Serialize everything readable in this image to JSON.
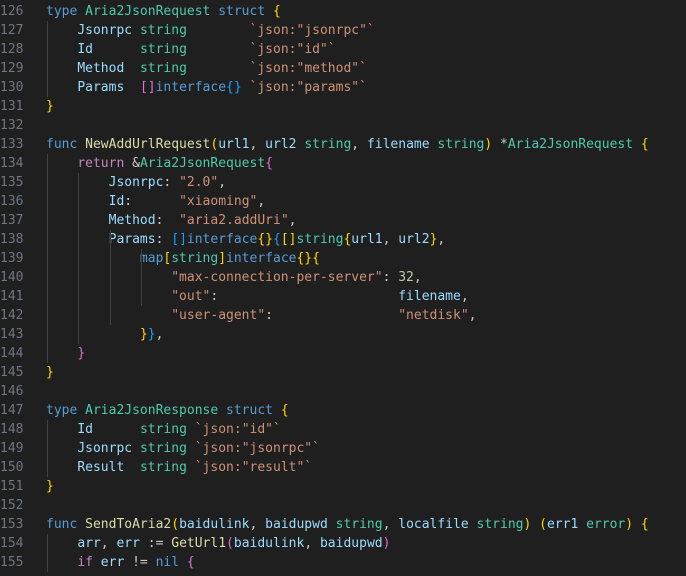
{
  "editor": {
    "language": "go",
    "theme": {
      "background": "#1f1f1f",
      "gutter": "#6e7681",
      "text": "#cccccc"
    },
    "lines": [
      {
        "n": "126",
        "tokens": [
          [
            "kw",
            "type"
          ],
          [
            "pl",
            " "
          ],
          [
            "ty",
            "Aria2JsonRequest"
          ],
          [
            "pl",
            " "
          ],
          [
            "kw",
            "struct"
          ],
          [
            "pl",
            " "
          ],
          [
            "b1",
            "{"
          ]
        ]
      },
      {
        "n": "127",
        "tokens": [
          [
            "pl",
            "    "
          ],
          [
            "var",
            "Jsonrpc"
          ],
          [
            "pl",
            " "
          ],
          [
            "ty",
            "string"
          ],
          [
            "pl",
            "        "
          ],
          [
            "str",
            "`json:\"jsonrpc\"`"
          ]
        ]
      },
      {
        "n": "128",
        "tokens": [
          [
            "pl",
            "    "
          ],
          [
            "var",
            "Id"
          ],
          [
            "pl",
            "      "
          ],
          [
            "ty",
            "string"
          ],
          [
            "pl",
            "        "
          ],
          [
            "str",
            "`json:\"id\"`"
          ]
        ]
      },
      {
        "n": "129",
        "tokens": [
          [
            "pl",
            "    "
          ],
          [
            "var",
            "Method"
          ],
          [
            "pl",
            "  "
          ],
          [
            "ty",
            "string"
          ],
          [
            "pl",
            "        "
          ],
          [
            "str",
            "`json:\"method\"`"
          ]
        ]
      },
      {
        "n": "130",
        "tokens": [
          [
            "pl",
            "    "
          ],
          [
            "var",
            "Params"
          ],
          [
            "pl",
            "  "
          ],
          [
            "b2",
            "[]"
          ],
          [
            "kw",
            "interface"
          ],
          [
            "b3",
            "{}"
          ],
          [
            "pl",
            " "
          ],
          [
            "str",
            "`json:\"params\"`"
          ]
        ]
      },
      {
        "n": "131",
        "tokens": [
          [
            "b1",
            "}"
          ]
        ]
      },
      {
        "n": "132",
        "tokens": []
      },
      {
        "n": "133",
        "tokens": [
          [
            "kw",
            "func"
          ],
          [
            "pl",
            " "
          ],
          [
            "fn",
            "NewAddUrlRequest"
          ],
          [
            "b1",
            "("
          ],
          [
            "var",
            "url1"
          ],
          [
            "pl",
            ", "
          ],
          [
            "var",
            "url2"
          ],
          [
            "pl",
            " "
          ],
          [
            "ty",
            "string"
          ],
          [
            "pl",
            ", "
          ],
          [
            "var",
            "filename"
          ],
          [
            "pl",
            " "
          ],
          [
            "ty",
            "string"
          ],
          [
            "b1",
            ")"
          ],
          [
            "pl",
            " *"
          ],
          [
            "ty",
            "Aria2JsonRequest"
          ],
          [
            "pl",
            " "
          ],
          [
            "b1",
            "{"
          ]
        ]
      },
      {
        "n": "134",
        "tokens": [
          [
            "pl",
            "    "
          ],
          [
            "ctl",
            "return"
          ],
          [
            "pl",
            " &"
          ],
          [
            "ty",
            "Aria2JsonRequest"
          ],
          [
            "b2",
            "{"
          ]
        ]
      },
      {
        "n": "135",
        "tokens": [
          [
            "pl",
            "        "
          ],
          [
            "var",
            "Jsonrpc"
          ],
          [
            "pl",
            ": "
          ],
          [
            "str",
            "\"2.0\""
          ],
          [
            "pl",
            ","
          ]
        ]
      },
      {
        "n": "136",
        "tokens": [
          [
            "pl",
            "        "
          ],
          [
            "var",
            "Id"
          ],
          [
            "pl",
            ":      "
          ],
          [
            "str",
            "\"xiaoming\""
          ],
          [
            "pl",
            ","
          ]
        ]
      },
      {
        "n": "137",
        "tokens": [
          [
            "pl",
            "        "
          ],
          [
            "var",
            "Method"
          ],
          [
            "pl",
            ":  "
          ],
          [
            "str",
            "\"aria2.addUri\""
          ],
          [
            "pl",
            ","
          ]
        ]
      },
      {
        "n": "138",
        "tokens": [
          [
            "pl",
            "        "
          ],
          [
            "var",
            "Params"
          ],
          [
            "pl",
            ": "
          ],
          [
            "b3",
            "[]"
          ],
          [
            "kw",
            "interface"
          ],
          [
            "b1",
            "{}"
          ],
          [
            "b3",
            "{"
          ],
          [
            "b1",
            "[]"
          ],
          [
            "ty",
            "string"
          ],
          [
            "b1",
            "{"
          ],
          [
            "var",
            "url1"
          ],
          [
            "pl",
            ", "
          ],
          [
            "var",
            "url2"
          ],
          [
            "b1",
            "}"
          ],
          [
            "pl",
            ","
          ]
        ]
      },
      {
        "n": "139",
        "tokens": [
          [
            "pl",
            "            "
          ],
          [
            "kw",
            "map"
          ],
          [
            "b1",
            "["
          ],
          [
            "ty",
            "string"
          ],
          [
            "b1",
            "]"
          ],
          [
            "kw",
            "interface"
          ],
          [
            "b1",
            "{}"
          ],
          [
            "b1",
            "{"
          ]
        ]
      },
      {
        "n": "140",
        "tokens": [
          [
            "pl",
            "                "
          ],
          [
            "str",
            "\"max-connection-per-server\""
          ],
          [
            "pl",
            ": "
          ],
          [
            "num",
            "32"
          ],
          [
            "pl",
            ","
          ]
        ]
      },
      {
        "n": "141",
        "tokens": [
          [
            "pl",
            "                "
          ],
          [
            "str",
            "\"out\""
          ],
          [
            "pl",
            ":                       "
          ],
          [
            "var",
            "filename"
          ],
          [
            "pl",
            ","
          ]
        ]
      },
      {
        "n": "142",
        "tokens": [
          [
            "pl",
            "                "
          ],
          [
            "str",
            "\"user-agent\""
          ],
          [
            "pl",
            ":                "
          ],
          [
            "str",
            "\"netdisk\""
          ],
          [
            "pl",
            ","
          ]
        ]
      },
      {
        "n": "143",
        "tokens": [
          [
            "pl",
            "            "
          ],
          [
            "b1",
            "}"
          ],
          [
            "b3",
            "}"
          ],
          [
            "pl",
            ","
          ]
        ]
      },
      {
        "n": "144",
        "tokens": [
          [
            "pl",
            "    "
          ],
          [
            "b2",
            "}"
          ]
        ]
      },
      {
        "n": "145",
        "tokens": [
          [
            "b1",
            "}"
          ]
        ]
      },
      {
        "n": "146",
        "tokens": []
      },
      {
        "n": "147",
        "tokens": [
          [
            "kw",
            "type"
          ],
          [
            "pl",
            " "
          ],
          [
            "ty",
            "Aria2JsonResponse"
          ],
          [
            "pl",
            " "
          ],
          [
            "kw",
            "struct"
          ],
          [
            "pl",
            " "
          ],
          [
            "b1",
            "{"
          ]
        ]
      },
      {
        "n": "148",
        "tokens": [
          [
            "pl",
            "    "
          ],
          [
            "var",
            "Id"
          ],
          [
            "pl",
            "      "
          ],
          [
            "ty",
            "string"
          ],
          [
            "pl",
            " "
          ],
          [
            "str",
            "`json:\"id\"`"
          ]
        ]
      },
      {
        "n": "149",
        "tokens": [
          [
            "pl",
            "    "
          ],
          [
            "var",
            "Jsonrpc"
          ],
          [
            "pl",
            " "
          ],
          [
            "ty",
            "string"
          ],
          [
            "pl",
            " "
          ],
          [
            "str",
            "`json:\"jsonrpc\"`"
          ]
        ]
      },
      {
        "n": "150",
        "tokens": [
          [
            "pl",
            "    "
          ],
          [
            "var",
            "Result"
          ],
          [
            "pl",
            "  "
          ],
          [
            "ty",
            "string"
          ],
          [
            "pl",
            " "
          ],
          [
            "str",
            "`json:\"result\"`"
          ]
        ]
      },
      {
        "n": "151",
        "tokens": [
          [
            "b1",
            "}"
          ]
        ]
      },
      {
        "n": "152",
        "tokens": []
      },
      {
        "n": "153",
        "tokens": [
          [
            "kw",
            "func"
          ],
          [
            "pl",
            " "
          ],
          [
            "fn",
            "SendToAria2"
          ],
          [
            "b1",
            "("
          ],
          [
            "var",
            "baidulink"
          ],
          [
            "pl",
            ", "
          ],
          [
            "var",
            "baidupwd"
          ],
          [
            "pl",
            " "
          ],
          [
            "ty",
            "string"
          ],
          [
            "pl",
            ", "
          ],
          [
            "var",
            "localfile"
          ],
          [
            "pl",
            " "
          ],
          [
            "ty",
            "string"
          ],
          [
            "b1",
            ")"
          ],
          [
            "pl",
            " "
          ],
          [
            "b1",
            "("
          ],
          [
            "var",
            "err1"
          ],
          [
            "pl",
            " "
          ],
          [
            "ty",
            "error"
          ],
          [
            "b1",
            ")"
          ],
          [
            "pl",
            " "
          ],
          [
            "b1",
            "{"
          ]
        ]
      },
      {
        "n": "154",
        "tokens": [
          [
            "pl",
            "    "
          ],
          [
            "var",
            "arr"
          ],
          [
            "pl",
            ", "
          ],
          [
            "var",
            "err"
          ],
          [
            "pl",
            " := "
          ],
          [
            "fn",
            "GetUrl1"
          ],
          [
            "b2",
            "("
          ],
          [
            "var",
            "baidulink"
          ],
          [
            "pl",
            ", "
          ],
          [
            "var",
            "baidupwd"
          ],
          [
            "b2",
            ")"
          ]
        ]
      },
      {
        "n": "155",
        "tokens": [
          [
            "pl",
            "    "
          ],
          [
            "ctl",
            "if"
          ],
          [
            "pl",
            " "
          ],
          [
            "var",
            "err"
          ],
          [
            "pl",
            " != "
          ],
          [
            "kw",
            "nil"
          ],
          [
            "pl",
            " "
          ],
          [
            "b2",
            "{"
          ]
        ]
      }
    ]
  }
}
